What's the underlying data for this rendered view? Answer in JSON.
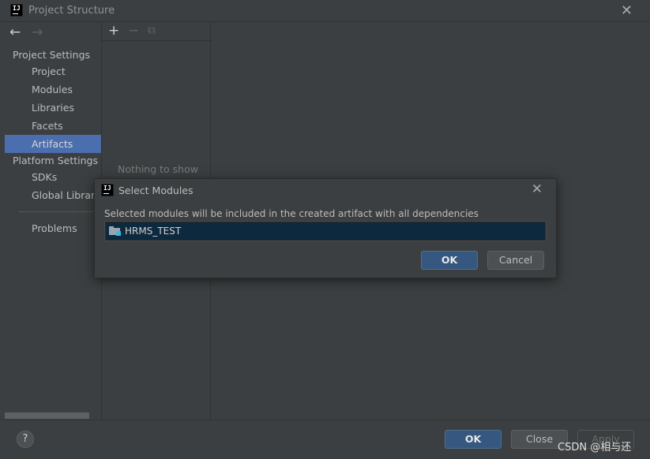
{
  "window": {
    "title": "Project Structure",
    "close_glyph": "✕"
  },
  "nav": {
    "back_glyph": "←",
    "forward_glyph": "→"
  },
  "sidebar": {
    "project_settings_header": "Project Settings",
    "project_items": [
      {
        "label": "Project"
      },
      {
        "label": "Modules"
      },
      {
        "label": "Libraries"
      },
      {
        "label": "Facets"
      },
      {
        "label": "Artifacts",
        "selected": true
      }
    ],
    "platform_settings_header": "Platform Settings",
    "platform_items": [
      {
        "label": "SDKs"
      },
      {
        "label": "Global Libraries"
      }
    ],
    "problems_label": "Problems"
  },
  "middle": {
    "add_glyph": "+",
    "remove_glyph": "−",
    "copy_glyph": "⧉",
    "empty_text": "Nothing to show"
  },
  "dialog": {
    "title": "Select Modules",
    "close_glyph": "✕",
    "description": "Selected modules will be included in the created artifact with all dependencies",
    "modules": [
      {
        "name": "HRMS_TEST",
        "icon": "module-folder-icon"
      }
    ],
    "ok_label": "OK",
    "cancel_label": "Cancel"
  },
  "footer": {
    "help_glyph": "?",
    "ok_label": "OK",
    "close_label": "Close",
    "apply_label": "Apply"
  },
  "watermark": "CSDN @相与还",
  "colors": {
    "background": "#3c3f41",
    "selection": "#4b6eaf",
    "primary_button": "#365880",
    "list_selection": "#0d293e"
  }
}
